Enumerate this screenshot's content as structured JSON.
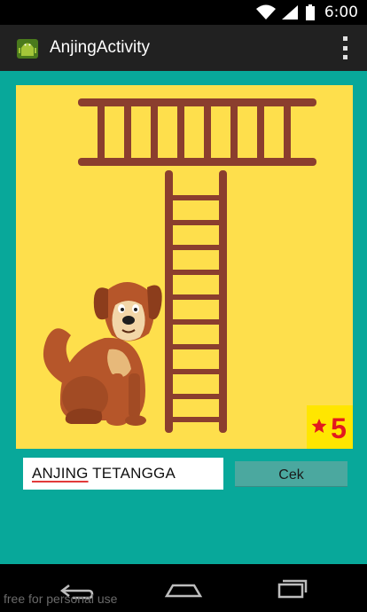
{
  "status_bar": {
    "time": "6:00"
  },
  "action_bar": {
    "title": "AnjingActivity"
  },
  "puzzle": {
    "score_value": "5",
    "colors": {
      "background": "#fedf4c",
      "ladder": "#8b3e2e",
      "badge": "#ffe600",
      "badge_text": "#e3191e"
    }
  },
  "answer": {
    "prefix": "ANJING",
    "suffix": " TETANGGA"
  },
  "check_button": {
    "label": "Cek"
  },
  "watermark": "free for personal use",
  "icons": [
    "android-icon",
    "wifi-icon",
    "signal-icon",
    "battery-icon",
    "overflow-menu-icon",
    "back-icon",
    "home-icon",
    "recents-icon",
    "star-icon"
  ],
  "colors": {
    "teal": "#08a89a",
    "action_bar": "#212121"
  }
}
